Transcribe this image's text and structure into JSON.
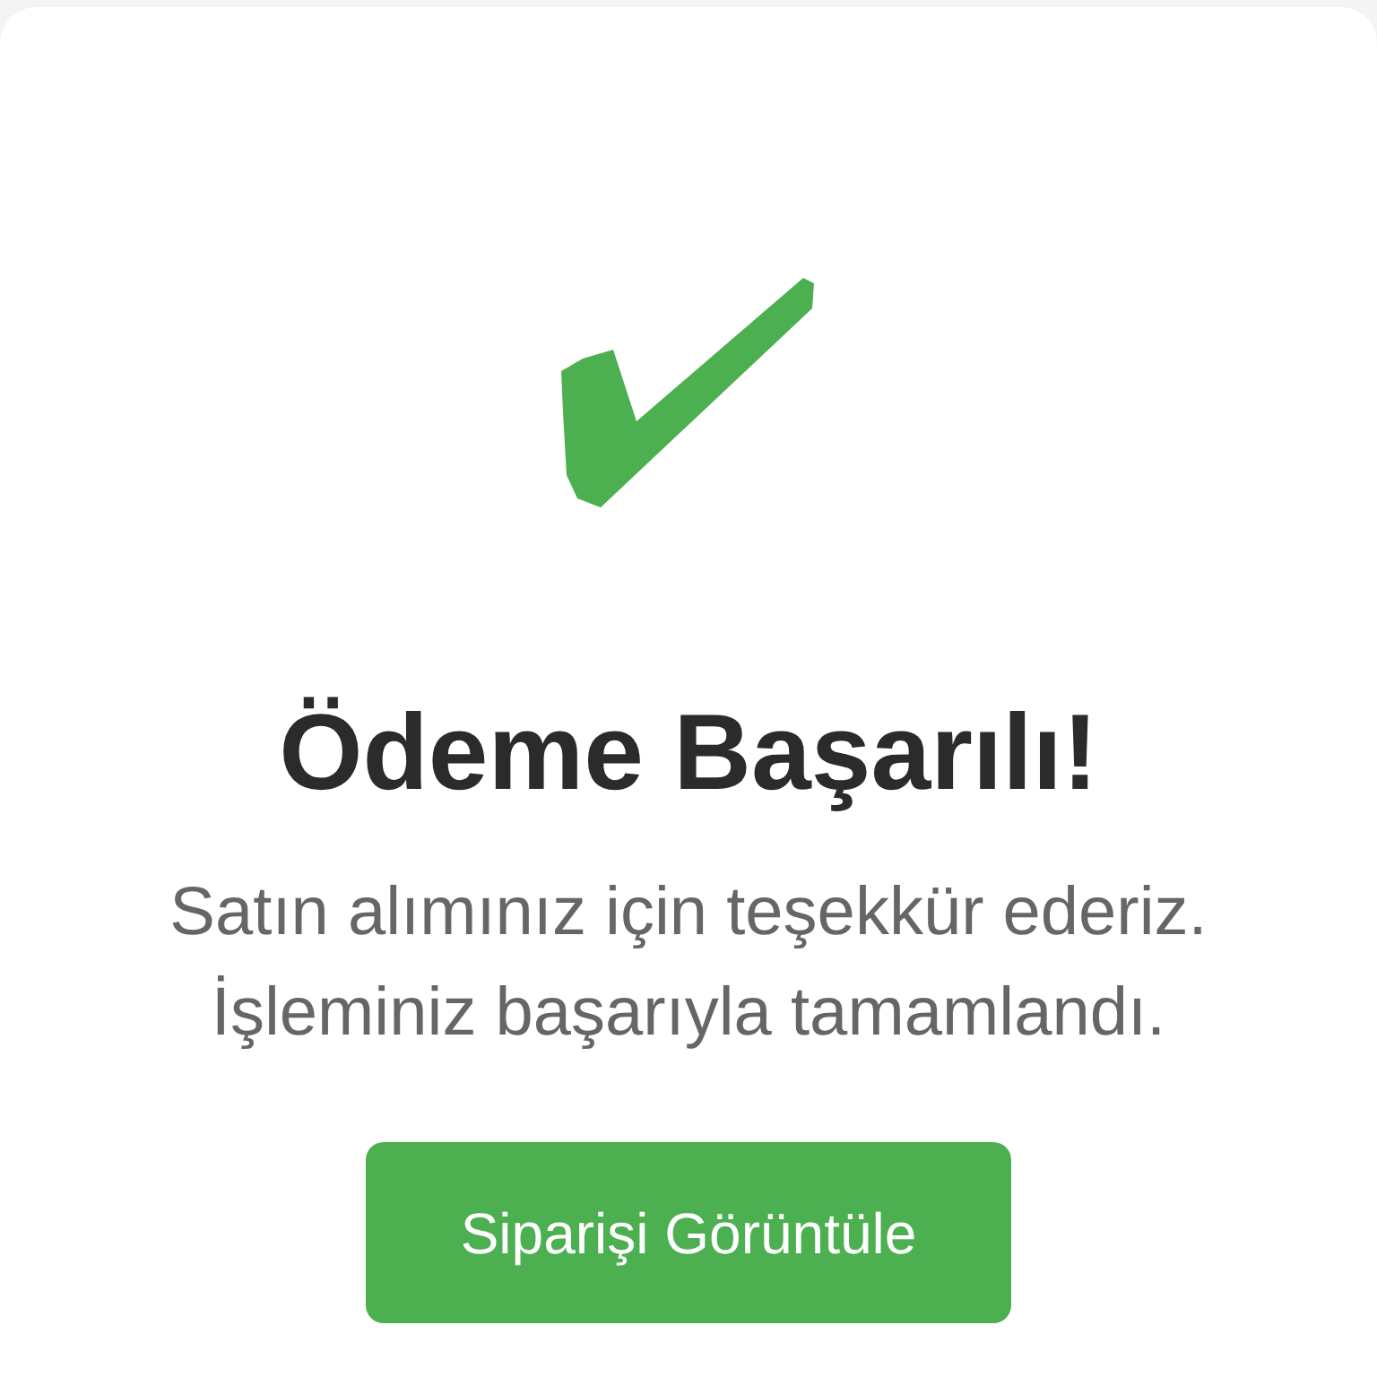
{
  "title": "Ödeme Başarılı!",
  "message": "Satın alımınız için teşekkür ederiz. İşleminiz başarıyla tamamlandı.",
  "button": {
    "label": "Siparişi Görüntüle"
  }
}
